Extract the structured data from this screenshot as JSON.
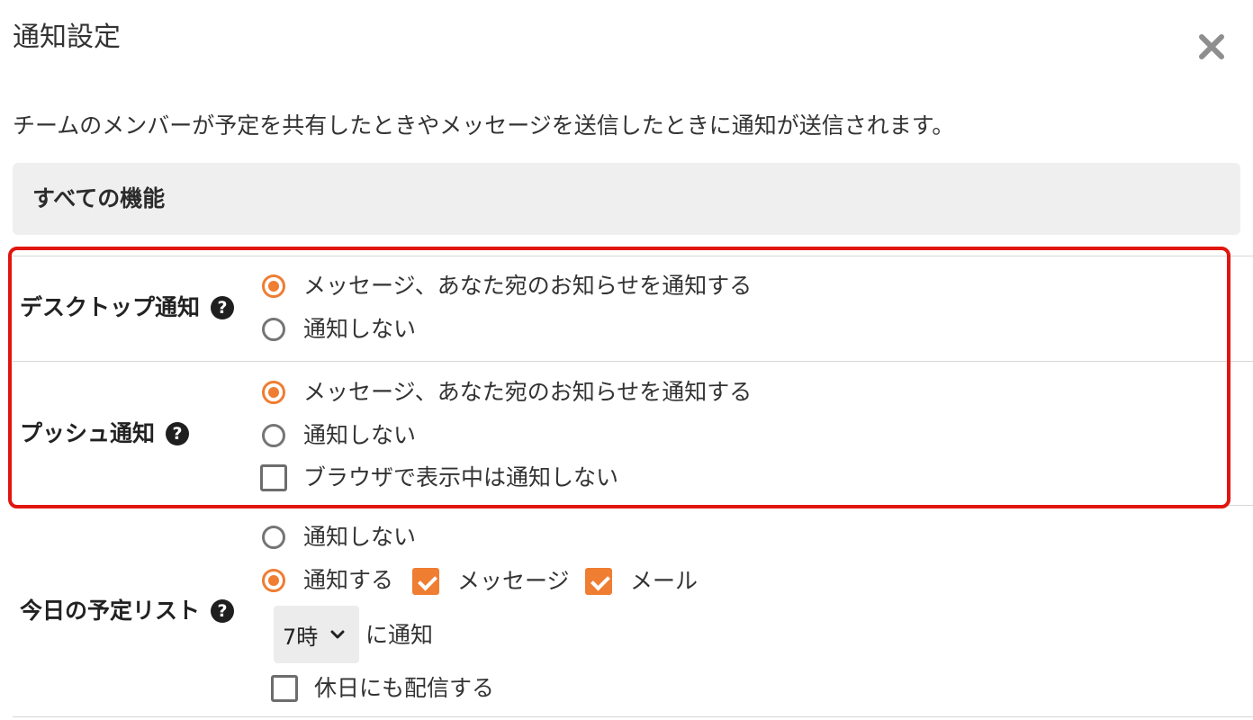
{
  "dialog": {
    "title": "通知設定",
    "description": "チームのメンバーが予定を共有したときやメッセージを送信したときに通知が送信されます。"
  },
  "section": {
    "title": "すべての機能"
  },
  "desktop": {
    "label": "デスクトップ通知",
    "options": [
      "メッセージ、あなた宛のお知らせを通知する",
      "通知しない"
    ],
    "selected": 0
  },
  "push": {
    "label": "プッシュ通知",
    "options": [
      "メッセージ、あなた宛のお知らせを通知する",
      "通知しない"
    ],
    "selected": 0,
    "checkbox_label": "ブラウザで表示中は通知しない",
    "checkbox_checked": false
  },
  "today": {
    "label": "今日の予定リスト",
    "option_off": "通知しない",
    "option_on": "通知する",
    "selected": "on",
    "message_label": "メッセージ",
    "message_checked": true,
    "mail_label": "メール",
    "mail_checked": true,
    "time_value": "7時",
    "time_suffix": "に通知",
    "holiday_label": "休日にも配信する",
    "holiday_checked": false
  },
  "icons": {
    "close": "close-icon",
    "help": "question-circle-icon",
    "select": "chevron-down-icon"
  },
  "colors": {
    "accent": "#ef7d32",
    "highlight_border": "#e0160f",
    "section_bg": "#efefef"
  }
}
